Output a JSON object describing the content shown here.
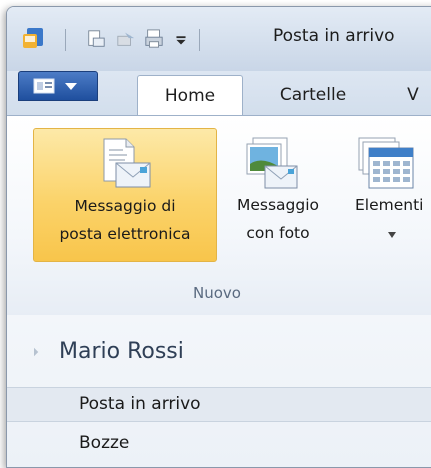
{
  "titlebar": {
    "title": "Posta in arrivo"
  },
  "quick_access": {
    "icons": [
      "app-icon",
      "new-item-icon",
      "send-receive-icon",
      "print-icon",
      "customize-qat-icon"
    ]
  },
  "tabs": {
    "file_label": "",
    "items": [
      {
        "label": "Home",
        "active": true
      },
      {
        "label": "Cartelle",
        "active": false
      },
      {
        "label": "V",
        "active": false
      }
    ]
  },
  "ribbon": {
    "buttons": [
      {
        "line1": "Messaggio di",
        "line2": "posta elettronica",
        "icon": "new-email-icon",
        "highlighted": true
      },
      {
        "line1": "Messaggio",
        "line2": "con foto",
        "icon": "photo-email-icon",
        "highlighted": false
      },
      {
        "line1": "Elementi",
        "line2": "",
        "icon": "calendar-items-icon",
        "highlighted": false,
        "has_dropdown": true
      }
    ],
    "group_label": "Nuovo"
  },
  "navigation": {
    "account": "Mario Rossi",
    "folders": [
      {
        "label": "Posta in arrivo",
        "selected": true
      },
      {
        "label": "Bozze",
        "selected": false
      }
    ]
  },
  "colors": {
    "file_button": "#2a5caa",
    "highlight": "#fbd36a",
    "account_text": "#2f3f56"
  }
}
